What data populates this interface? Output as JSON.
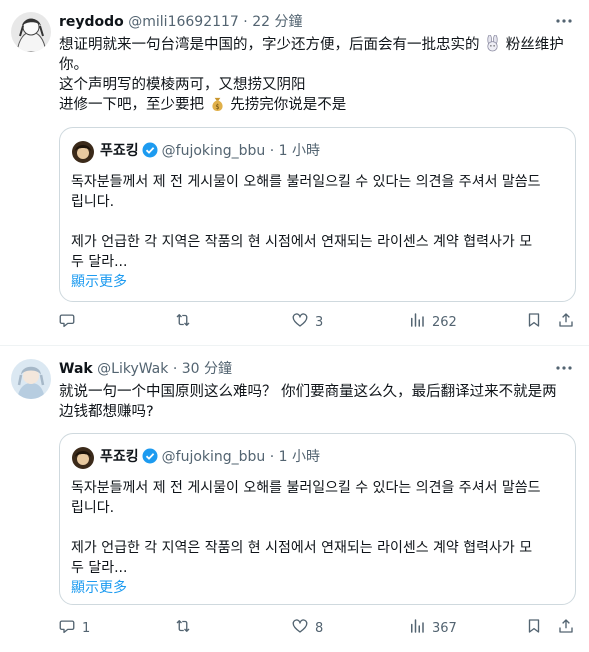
{
  "tweets": [
    {
      "author": {
        "name": "reydodo",
        "handle": "@mili16692117",
        "time": "22 分鐘"
      },
      "text_lines": [
        "想证明就来一句台湾是中国的，字少还方便，后面会有一批忠实的",
        "粉丝维护",
        "你。",
        "这个声明写的模棱两可，又想捞又阴阳",
        "进修一下吧，至少要把",
        "先捞完你说是不是"
      ],
      "quote": {
        "name": "푸죠킹",
        "handle": "@fujoking_bbu",
        "time": "1 小時",
        "lines": [
          "독자분들께서 제 전 게시물이 오해를 불러일으킬 수 있다는 의견을 주셔서 말씀드",
          "립니다.",
          "제가 언급한 각 지역은 작품의 현 시점에서 연재되는 라이센스 계약 협력사가 모",
          "두 달라..."
        ],
        "show_more": "顯示更多"
      },
      "actions": {
        "replies": "",
        "retweets": "",
        "likes": "3",
        "views": "262"
      }
    },
    {
      "author": {
        "name": "Wak",
        "handle": "@LikyWak",
        "time": "30 分鐘"
      },
      "text_lines": [
        "就说一句一个中国原则这么难吗？ 你们要商量这么久，最后翻译过来不就是两",
        "边钱都想赚吗?"
      ],
      "quote": {
        "name": "푸죠킹",
        "handle": "@fujoking_bbu",
        "time": "1 小時",
        "lines": [
          "독자분들께서 제 전 게시물이 오해를 불러일으킬 수 있다는 의견을 주셔서 말씀드",
          "립니다.",
          "제가 언급한 각 지역은 작품의 현 시점에서 연재되는 라이센스 계약 협력사가 모",
          "두 달라..."
        ],
        "show_more": "顯示更多"
      },
      "actions": {
        "replies": "1",
        "retweets": "",
        "likes": "8",
        "views": "367"
      }
    }
  ],
  "icons": {
    "reply": "speech-bubble-icon",
    "retweet": "retweet-arrows-icon",
    "like": "heart-icon",
    "views": "bar-chart-icon",
    "bookmark": "bookmark-icon",
    "share": "upload-share-icon",
    "more": "more-dots-icon",
    "verified": "verified-badge-icon",
    "rabbit": "rabbit-emoji-icon",
    "moneybag": "money-bag-emoji-icon"
  },
  "colors": {
    "text": "#0f1419",
    "secondary": "#536471",
    "link": "#1d9bf0",
    "border": "#cfd9de",
    "verified": "#1d9bf0"
  }
}
